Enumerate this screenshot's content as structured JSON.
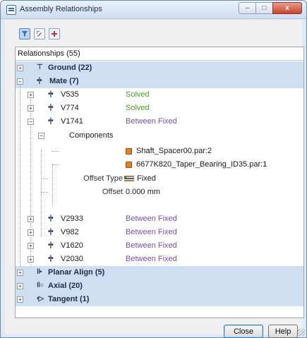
{
  "window": {
    "title": "Assembly Relationships",
    "minimize": "‒",
    "maximize": "□",
    "close": "x"
  },
  "toolbar": {
    "buttons": [
      "filter-icon",
      "edit-relationship-icon",
      "add-relationship-icon"
    ]
  },
  "tree": {
    "header": "Relationships  (55)",
    "groups": {
      "ground": {
        "label": "Ground  (22)"
      },
      "mate": {
        "label": "Mate  (7)"
      },
      "planar": {
        "label": "Planar Align  (5)"
      },
      "axial": {
        "label": "Axial  (20)"
      },
      "tangent": {
        "label": "Tangent  (1)"
      }
    },
    "mates": {
      "v535": {
        "name": "V535",
        "status": "Solved"
      },
      "v774": {
        "name": "V774",
        "status": "Solved"
      },
      "v1741": {
        "name": "V1741",
        "status": "Between Fixed"
      },
      "v2933": {
        "name": "V2933",
        "status": "Between Fixed"
      },
      "v982": {
        "name": "V982",
        "status": "Between Fixed"
      },
      "v1620": {
        "name": "V1620",
        "status": "Between Fixed"
      },
      "v2030": {
        "name": "V2030",
        "status": "Between Fixed"
      }
    },
    "components": {
      "label": "Components",
      "items": [
        "Shaft_Spacer00.par:2",
        "6677K820_Taper_Bearing_ID35.par:1"
      ]
    },
    "offset_type": {
      "label": "Offset Type",
      "value": "Fixed"
    },
    "offset": {
      "label": "Offset",
      "value": "0.000 mm"
    }
  },
  "buttons": {
    "close": "Close",
    "help": "Help"
  },
  "colors": {
    "group_highlight": "#cfdff2",
    "solved": "#4a9c2c",
    "between_fixed": "#7c4ea6"
  }
}
